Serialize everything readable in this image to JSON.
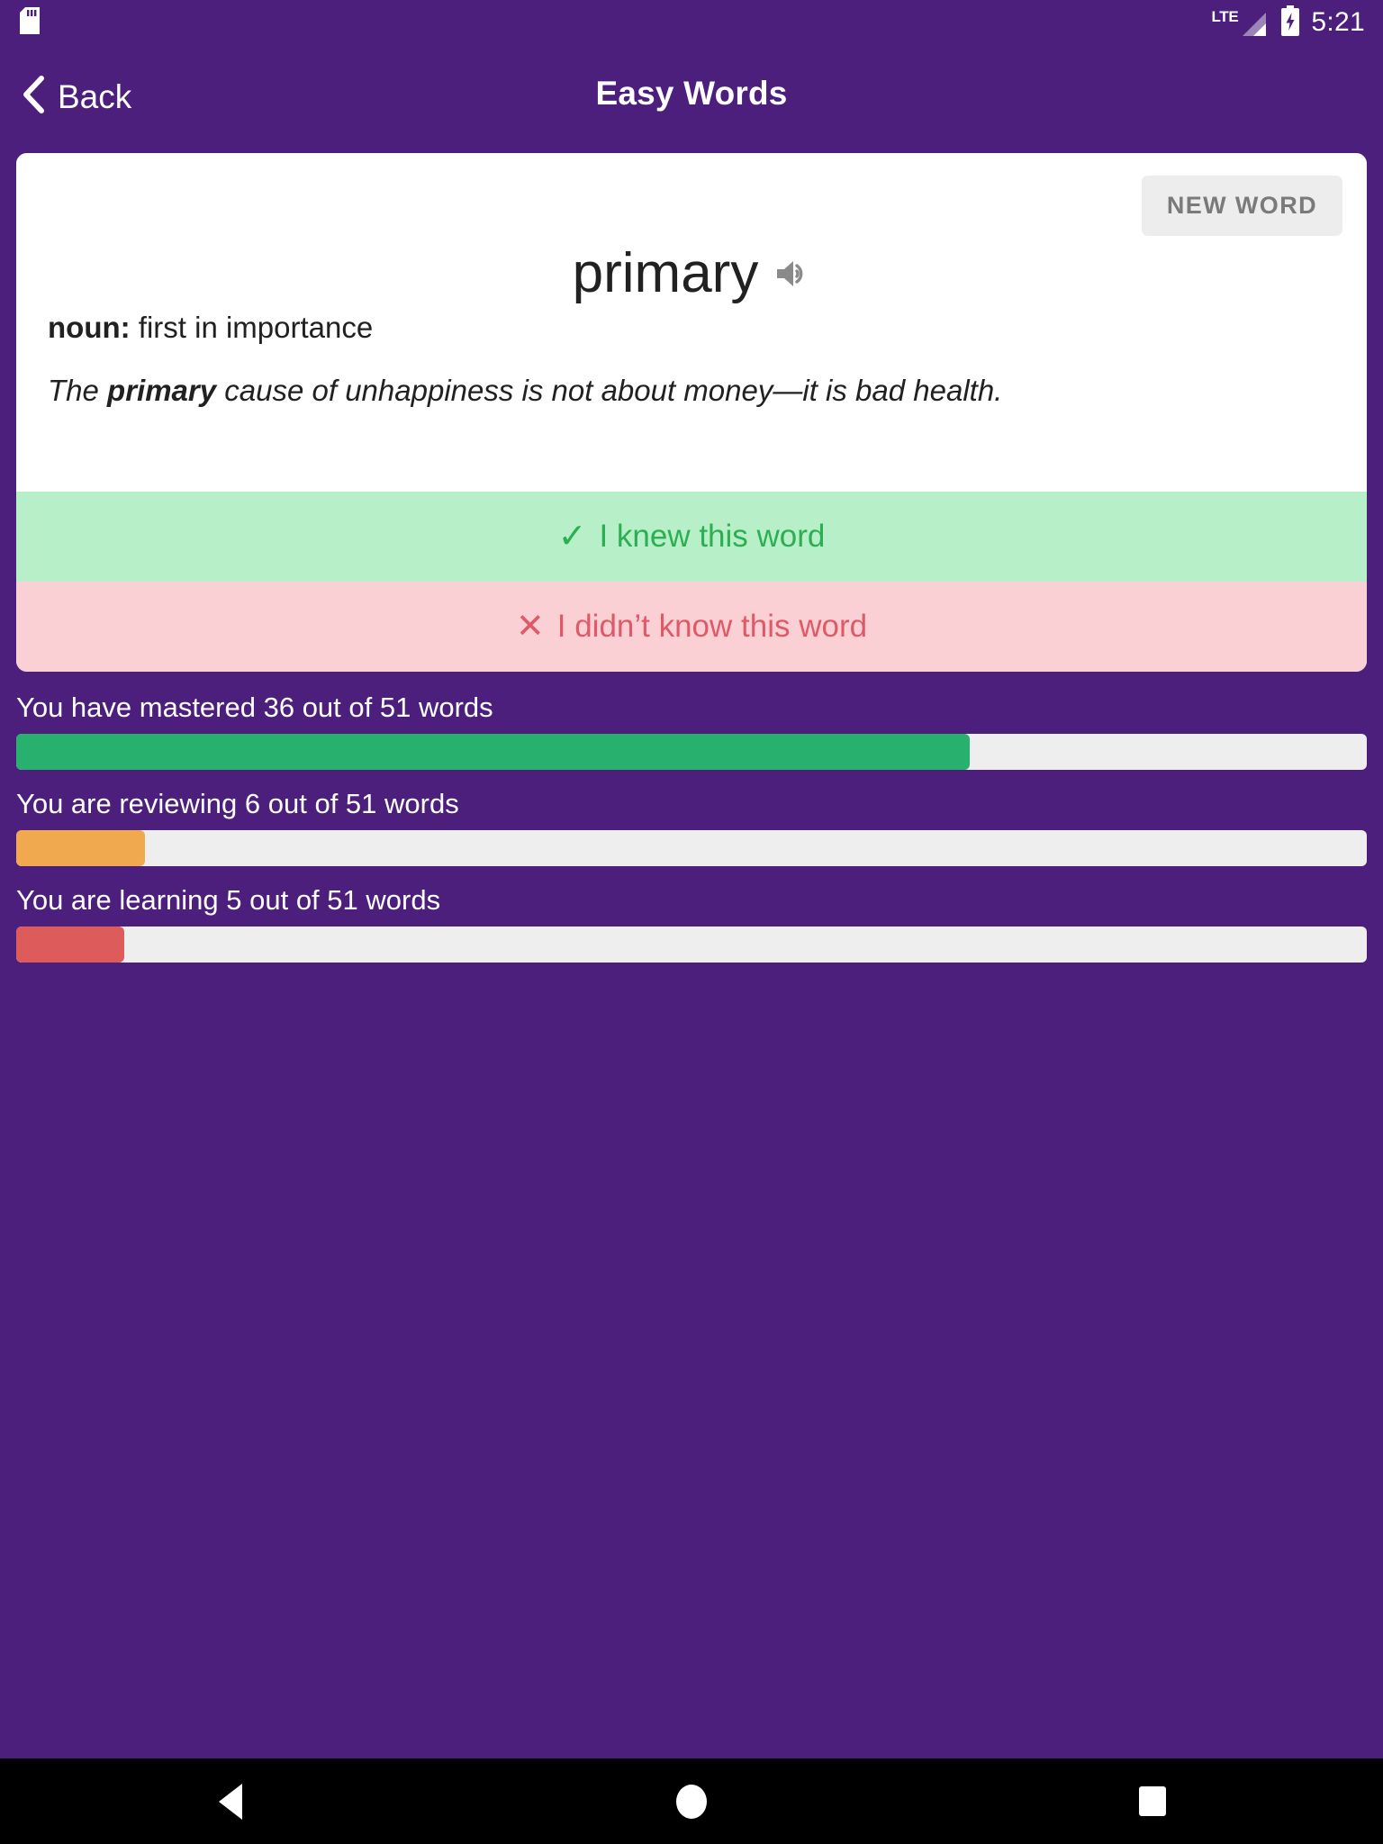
{
  "status_bar": {
    "notification_icon": "sd-card-icon",
    "network_label": "LTE",
    "battery_icon": "battery-charging-icon",
    "time": "5:21"
  },
  "app_bar": {
    "back_label": "Back",
    "back_icon": "chevron-left-icon",
    "title": "Easy Words"
  },
  "card": {
    "new_word_label": "NEW WORD",
    "word": "primary",
    "speaker_icon": "speaker-volume-icon",
    "part_of_speech": "noun:",
    "definition": " first in importance",
    "example": {
      "before": "The ",
      "highlight": "primary",
      "after": " cause of unhappiness is not about money—it is bad health."
    },
    "known_mark": "✓",
    "known_label": "I knew this word",
    "unknown_mark": "✕",
    "unknown_label": "I didn’t know this word"
  },
  "progress": {
    "total_words": 51,
    "items": [
      {
        "label": "You have mastered 36 out of 51 words",
        "count": 36,
        "percent": 70.6,
        "color": "#28b06f"
      },
      {
        "label": "You are reviewing 6 out of 51 words",
        "count": 6,
        "percent": 9.5,
        "color": "#f0a94f"
      },
      {
        "label": "You are learning 5 out of 51 words",
        "count": 5,
        "percent": 8.0,
        "color": "#dd5b5b"
      }
    ]
  },
  "nav_bar": {
    "back_icon": "triangle-back-icon",
    "home_icon": "circle-home-icon",
    "recents_icon": "square-recents-icon"
  },
  "colors": {
    "background": "#4d1f7c",
    "card": "#ffffff",
    "known": "#b7f0c8",
    "unknown": "#fbd0d4",
    "mastered": "#28b06f",
    "reviewing": "#f0a94f",
    "learning": "#dd5b5b"
  }
}
